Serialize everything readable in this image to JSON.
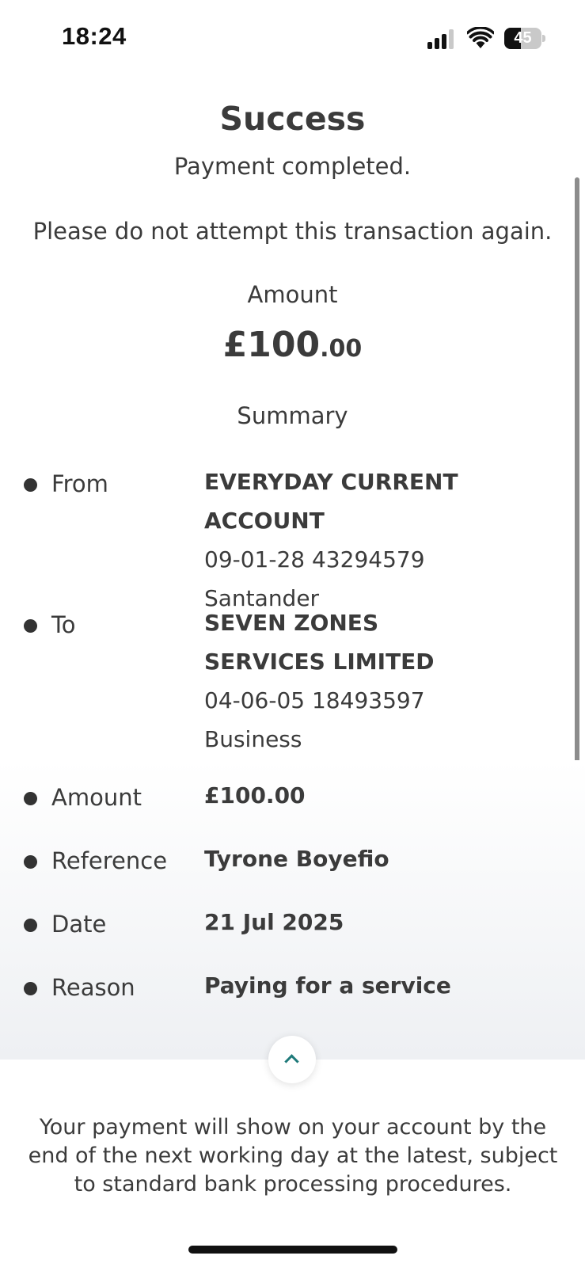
{
  "status_bar": {
    "time": "18:24",
    "battery": "45",
    "battery_level": 0.45
  },
  "header": {
    "title": "Success",
    "subtitle": "Payment completed.",
    "warning": "Please do not attempt this transaction again."
  },
  "amount": {
    "label": "Amount",
    "main": "£100",
    "pence": ".00"
  },
  "summary": {
    "heading": "Summary",
    "from": {
      "label": "From",
      "account_name": "EVERYDAY CURRENT ACCOUNT",
      "account_number": "09-01-28 43294579",
      "bank": "Santander"
    },
    "to": {
      "label": "To",
      "name_line1": "SEVEN ZONES",
      "name_line2": "SERVICES LIMITED",
      "account_number": "04-06-05 18493597",
      "type": "Business"
    },
    "amount": {
      "label": "Amount",
      "value": "£100.00"
    },
    "reference": {
      "label": "Reference",
      "value": "Tyrone Boyefio"
    },
    "date": {
      "label": "Date",
      "value": "21 Jul 2025"
    },
    "reason": {
      "label": "Reason",
      "value": "Paying for a service"
    }
  },
  "footer": {
    "note": "Your payment will show on your account by the end of the next working day at the latest, subject to standard bank processing procedures."
  },
  "colors": {
    "accent": "#1f7a7a",
    "text": "#3b3b3b"
  },
  "icons": {
    "collapse": "chevron-up-icon"
  }
}
